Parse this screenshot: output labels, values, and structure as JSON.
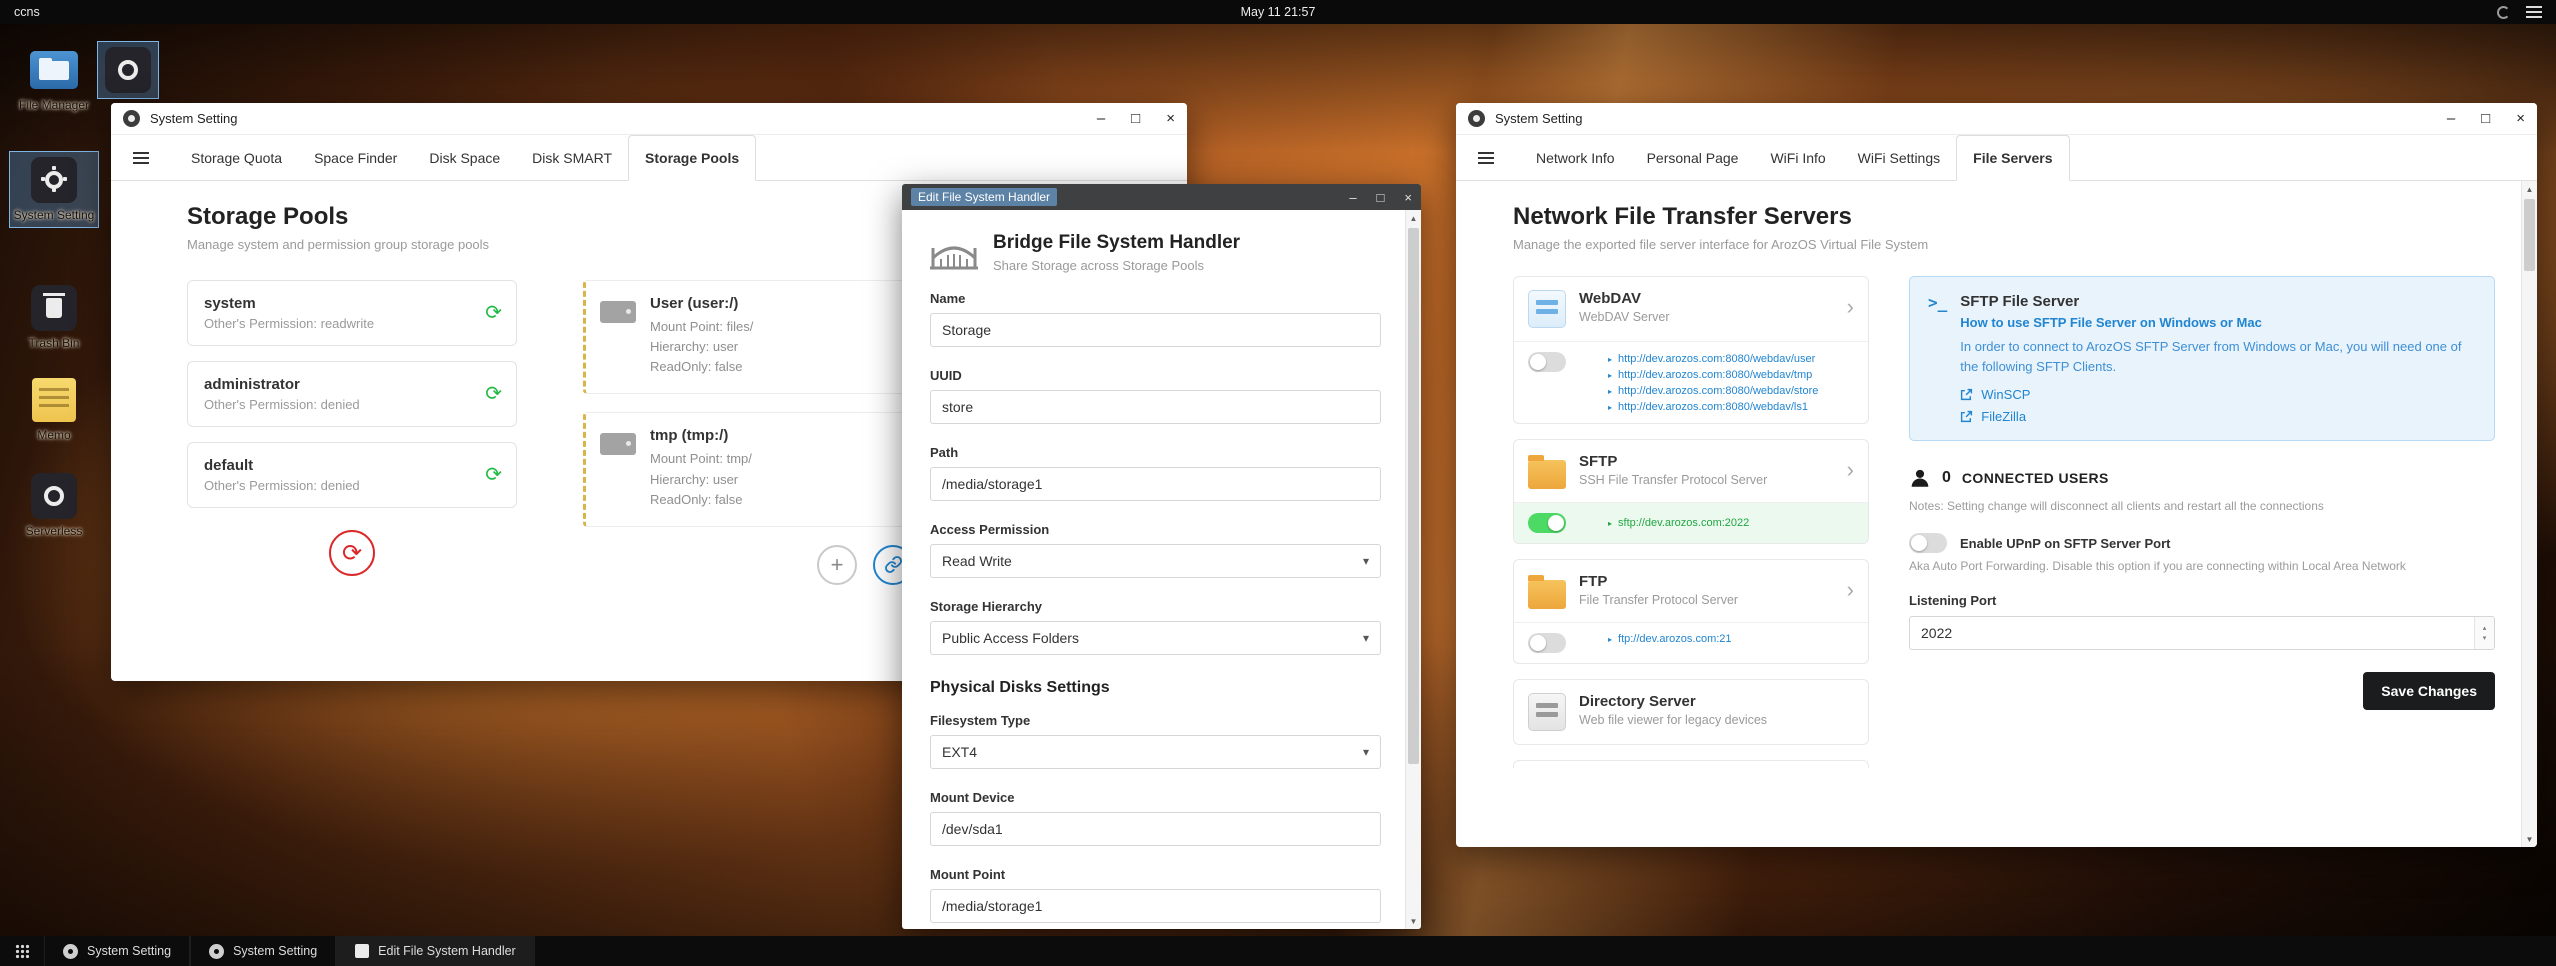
{
  "topbar": {
    "hostname": "ccns",
    "clock": "May 11 21:57"
  },
  "icons": {
    "minimize": "–",
    "maximize": "□",
    "close": "×",
    "sync": "⟳",
    "chevron_right": "›",
    "caret_down": "▾",
    "link_bullet": "▸",
    "plus": "+",
    "scroll_up": "▲",
    "scroll_down": "▼",
    "spin_up": "▴",
    "spin_down": "▾",
    "terminal": ">_"
  },
  "colors": {
    "accent": "#2185d0",
    "green": "#21ba45",
    "red": "#db2828",
    "toggle_on": "#4cd964",
    "dashed_warning": "#d9b44a"
  },
  "desktop_icons": [
    {
      "label": "File Manager"
    },
    {
      "label": "System Setting"
    },
    {
      "label": "Trash Bin"
    },
    {
      "label": "Memo"
    },
    {
      "label": "Serverless"
    }
  ],
  "storage_window": {
    "title": "System Setting",
    "tabs": [
      "Storage Quota",
      "Space Finder",
      "Disk Space",
      "Disk SMART",
      "Storage Pools"
    ],
    "heading": "Storage Pools",
    "subheading": "Manage system and permission group storage pools",
    "pools": [
      {
        "name": "system",
        "permission": "Other's Permission: readwrite"
      },
      {
        "name": "administrator",
        "permission": "Other's Permission: denied"
      },
      {
        "name": "default",
        "permission": "Other's Permission: denied"
      }
    ],
    "mounts": [
      {
        "name": "User (user:/)",
        "mount_point": "Mount Point: files/",
        "hierarchy": "Hierarchy: user",
        "readonly": "ReadOnly: false"
      },
      {
        "name": "tmp (tmp:/)",
        "mount_point": "Mount Point: tmp/",
        "hierarchy": "Hierarchy: user",
        "readonly": "ReadOnly: false"
      }
    ]
  },
  "edit_dialog": {
    "title": "Edit File System Handler",
    "heading": "Bridge File System Handler",
    "subheading": "Share Storage across Storage Pools",
    "section": "Physical Disks Settings",
    "fields": {
      "name": {
        "label": "Name",
        "value": "Storage"
      },
      "uuid": {
        "label": "UUID",
        "value": "store"
      },
      "path": {
        "label": "Path",
        "value": "/media/storage1"
      },
      "access_permission": {
        "label": "Access Permission",
        "value": "Read Write"
      },
      "storage_hierarchy": {
        "label": "Storage Hierarchy",
        "value": "Public Access Folders"
      },
      "filesystem_type": {
        "label": "Filesystem Type",
        "value": "EXT4"
      },
      "mount_device": {
        "label": "Mount Device",
        "value": "/dev/sda1"
      },
      "mount_point": {
        "label": "Mount Point",
        "value": "/media/storage1"
      }
    }
  },
  "network_window": {
    "title": "System Setting",
    "tabs": [
      "Network Info",
      "Personal Page",
      "WiFi Info",
      "WiFi Settings",
      "File Servers"
    ],
    "heading": "Network File Transfer Servers",
    "subheading": "Manage the exported file server interface for ArozOS Virtual File System",
    "servers": [
      {
        "name": "WebDAV",
        "desc": "WebDAV Server",
        "enabled": false,
        "links": [
          "http://dev.arozos.com:8080/webdav/user",
          "http://dev.arozos.com:8080/webdav/tmp",
          "http://dev.arozos.com:8080/webdav/store",
          "http://dev.arozos.com:8080/webdav/ls1"
        ]
      },
      {
        "name": "SFTP",
        "desc": "SSH File Transfer Protocol Server",
        "enabled": true,
        "links": [
          "sftp://dev.arozos.com:2022"
        ]
      },
      {
        "name": "FTP",
        "desc": "File Transfer Protocol Server",
        "enabled": false,
        "links": [
          "ftp://dev.arozos.com:21"
        ]
      },
      {
        "name": "Directory Server",
        "desc": "Web file viewer for legacy devices"
      }
    ],
    "sftp_panel": {
      "title": "SFTP File Server",
      "subtitle": "How to use SFTP File Server on Windows or Mac",
      "body": "In order to connect to ArozOS SFTP Server from Windows or Mac, you will need one of the following SFTP Clients.",
      "clients": [
        "WinSCP",
        "FileZilla"
      ]
    },
    "connected_users": {
      "count": "0",
      "label": "CONNECTED USERS"
    },
    "notes": "Notes: Setting change will disconnect all clients and restart all the connections",
    "upnp": {
      "label": "Enable UPnP on SFTP Server Port",
      "desc": "Aka Auto Port Forwarding. Disable this option if you are connecting within Local Area Network",
      "enabled": false
    },
    "listening_port": {
      "label": "Listening Port",
      "value": "2022"
    },
    "save_button": "Save Changes"
  },
  "taskbar": {
    "items": [
      "System Setting",
      "System Setting",
      "Edit File System Handler"
    ]
  }
}
